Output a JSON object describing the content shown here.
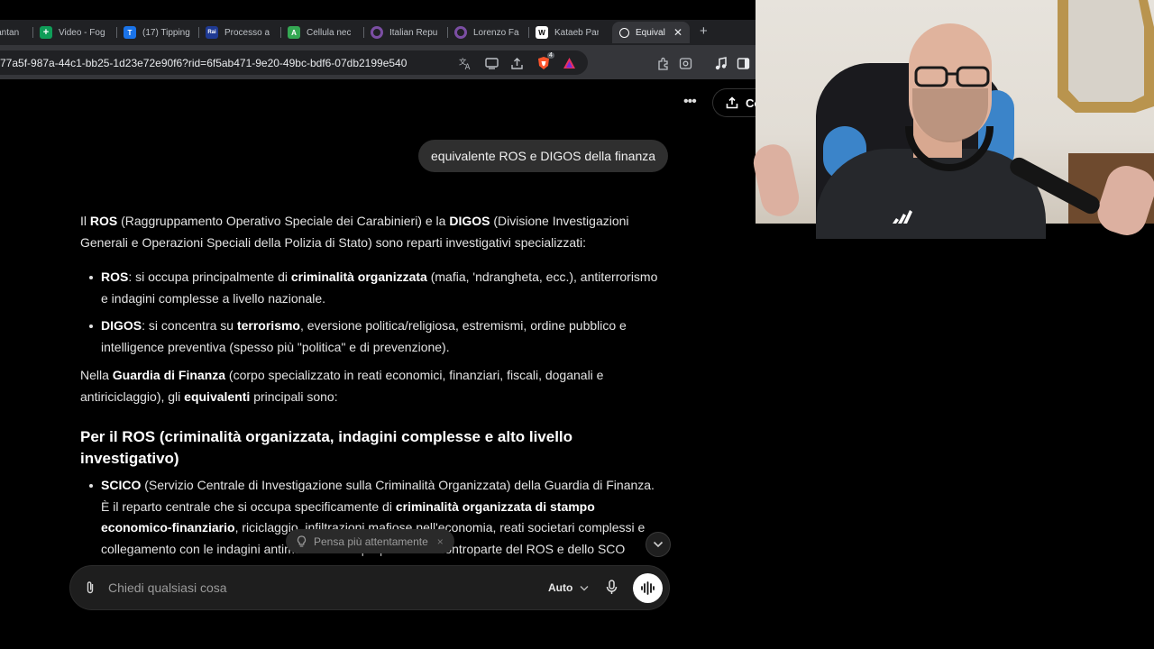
{
  "browser": {
    "tabs": [
      {
        "label": "Fantan",
        "icon": "generic-tab-icon",
        "color": "#5f6368"
      },
      {
        "label": "Video - Fog",
        "icon": "sheets-icon",
        "color": "#0f9d58"
      },
      {
        "label": "(17) Tipping",
        "icon": "tipping-icon",
        "color": "#1a73e8"
      },
      {
        "label": "Processo a",
        "icon": "rai-icon",
        "color": "#1f3a93"
      },
      {
        "label": "Cellula nec",
        "icon": "a-icon",
        "color": "#34a853"
      },
      {
        "label": "Italian Repu",
        "icon": "wiki-purple-icon",
        "color": "#7b4ea3"
      },
      {
        "label": "Lorenzo Fa",
        "icon": "wiki-purple-icon",
        "color": "#7b4ea3"
      },
      {
        "label": "Kataeb Part",
        "icon": "wikipedia-icon",
        "color": "#ffffff"
      },
      {
        "label": "Equival",
        "icon": "chatgpt-icon",
        "color": "#ffffff",
        "active": true
      }
    ],
    "url": "77a5f-987a-44c1-bb25-1d23e72e90f6?rid=6f5ab471-9e20-49bc-bdf6-07db2199e540",
    "brave_badge": "4"
  },
  "header": {
    "share_label": "Co"
  },
  "chat": {
    "user_message": "equivalente ROS e DIGOS della finanza",
    "intro": {
      "pre": "Il ",
      "ros": "ROS",
      "mid1": " (Raggruppamento Operativo Speciale dei Carabinieri) e la ",
      "digos": "DIGOS",
      "mid2": " (Divisione Investigazioni Generali e Operazioni Speciali della Polizia di Stato) sono reparti investigativi specializzati:"
    },
    "bullets": [
      {
        "bold": "ROS",
        "pre": ": si occupa principalmente di ",
        "b2": "criminalità organizzata",
        "post": " (mafia, 'ndrangheta, ecc.), antiterrorismo e indagini complesse a livello nazionale."
      },
      {
        "bold": "DIGOS",
        "pre": ": si concentra su ",
        "b2": "terrorismo",
        "post": ", eversione politica/religiosa, estremismi, ordine pubblico e intelligence preventiva (spesso più \"politica\" e di prevenzione)."
      }
    ],
    "gdf": {
      "pre": "Nella ",
      "b1": "Guardia di Finanza",
      "mid": " (corpo specializzato in reati economici, finanziari, fiscali, doganali e antiriciclaggio), gli ",
      "b2": "equivalenti",
      "post": " principali sono:"
    },
    "section_title": "Per il ROS (criminalità organizzata, indagini complesse e alto livello investigativo)",
    "scico": {
      "b1": "SCICO",
      "t1": " (Servizio Centrale di Investigazione sulla Criminalità Organizzata) della Guardia di Finanza.",
      "t2": "È il reparto centrale che si occupa specificamente di ",
      "b2": "criminalità organizzata di stampo economico-finanziario",
      "t3": ", riciclaggio, infiltrazioni mafiose nell'economia, reati societari complessi e collegamento con le indagini antimafia. Nasce proprio come controparte del ROS e dello SCO (Polizia) per coordinare le attività contro la cri"
    }
  },
  "think_chip": {
    "label": "Pensa più attentamente",
    "close": "×"
  },
  "composer": {
    "placeholder": "Chiedi qualsiasi cosa",
    "model_label": "Auto"
  }
}
